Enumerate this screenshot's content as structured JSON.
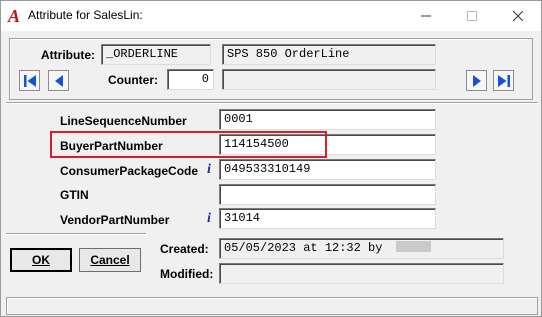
{
  "window": {
    "title": "Attribute for SalesLin:",
    "app_icon": "A",
    "colors": {
      "highlight": "#d4202d",
      "info_icon": "#1a2aa8",
      "nav_arrow": "#1453d8"
    }
  },
  "header": {
    "attribute_label": "Attribute:",
    "attribute_code": "_ORDERLINE",
    "attribute_desc": "SPS 850 OrderLine",
    "counter_label": "Counter:",
    "counter_value": "0",
    "extra_value": ""
  },
  "fields": [
    {
      "label": "LineSequenceNumber",
      "value": "0001",
      "info": false
    },
    {
      "label": "BuyerPartNumber",
      "value": "114154500",
      "info": false
    },
    {
      "label": "ConsumerPackageCode",
      "value": "049533310149",
      "info": true
    },
    {
      "label": "GTIN",
      "value": "",
      "info": false
    },
    {
      "label": "VendorPartNumber",
      "value": "31014",
      "info": true
    }
  ],
  "footer": {
    "ok_label": "OK",
    "cancel_label": "Cancel",
    "created_label": "Created:",
    "created_value": "05/05/2023 at 12:32 by",
    "modified_label": "Modified:",
    "modified_value": ""
  },
  "status": {
    "text": ""
  }
}
